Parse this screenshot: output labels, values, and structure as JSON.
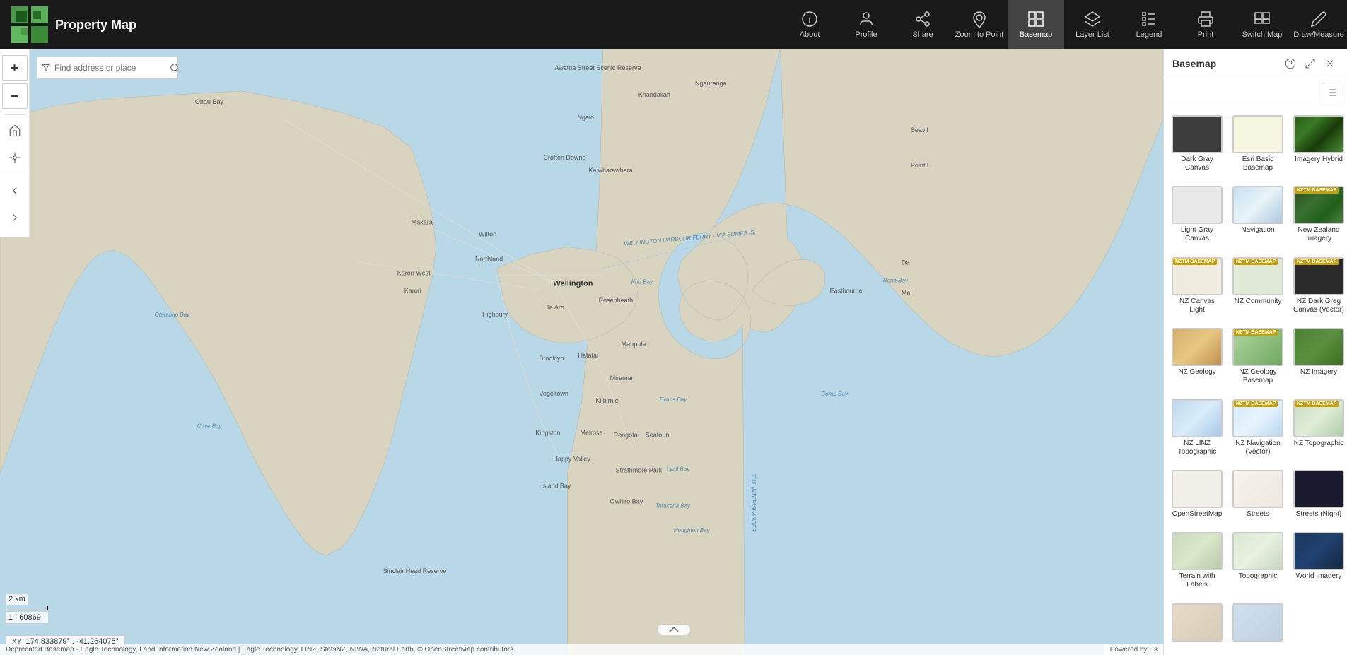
{
  "app": {
    "title": "Property Map"
  },
  "toolbar": {
    "buttons": [
      {
        "id": "about",
        "label": "About",
        "icon": "info"
      },
      {
        "id": "profile",
        "label": "Profile",
        "icon": "profile"
      },
      {
        "id": "share",
        "label": "Share",
        "icon": "share"
      },
      {
        "id": "zoom-to-point",
        "label": "Zoom to Point",
        "icon": "zoom-point"
      },
      {
        "id": "basemap",
        "label": "Basemap",
        "icon": "basemap",
        "active": true
      },
      {
        "id": "layer-list",
        "label": "Layer List",
        "icon": "layer-list"
      },
      {
        "id": "legend",
        "label": "Legend",
        "icon": "legend"
      },
      {
        "id": "print",
        "label": "Print",
        "icon": "print"
      },
      {
        "id": "switch-map",
        "label": "Switch Map",
        "icon": "switch-map"
      },
      {
        "id": "draw-measure",
        "label": "Draw/Measure",
        "icon": "draw"
      }
    ]
  },
  "sidebar": {
    "zoom_in": "+",
    "zoom_out": "−"
  },
  "search": {
    "placeholder": "Find address or place"
  },
  "basemap_panel": {
    "title": "Basemap",
    "items": [
      {
        "id": "dark-gray-canvas",
        "label": "Dark Gray Canvas",
        "thumb_class": "thumb-dark-gray"
      },
      {
        "id": "esri-basic",
        "label": "Esri Basic Basemap",
        "thumb_class": "thumb-esri-basic"
      },
      {
        "id": "imagery-hybrid",
        "label": "Imagery Hybrid",
        "thumb_class": "thumb-imagery-hybrid"
      },
      {
        "id": "light-gray-canvas",
        "label": "Light Gray Canvas",
        "thumb_class": "thumb-light-gray"
      },
      {
        "id": "navigation",
        "label": "Navigation",
        "thumb_class": "thumb-navigation"
      },
      {
        "id": "new-zealand-imagery",
        "label": "New Zealand Imagery",
        "thumb_class": "thumb-nz-imagery",
        "badge": "NZTM BASEMAP"
      },
      {
        "id": "nz-canvas-light",
        "label": "NZ Canvas Light",
        "thumb_class": "thumb-nz-canvas-light",
        "badge": "NZTM BASEMAP"
      },
      {
        "id": "nz-community",
        "label": "NZ Community",
        "thumb_class": "thumb-nz-community",
        "badge": "NZTM BASEMAP"
      },
      {
        "id": "nz-dark-greg",
        "label": "NZ Dark Greg Canvas (Vector)",
        "thumb_class": "thumb-nz-dark-gray",
        "badge": "NZTM BASEMAP"
      },
      {
        "id": "nz-geology",
        "label": "NZ Geology",
        "thumb_class": "thumb-nz-geology"
      },
      {
        "id": "nz-geology-basemap",
        "label": "NZ Geology Basemap",
        "thumb_class": "thumb-nz-geology-bm",
        "badge": "NZTM BASEMAP"
      },
      {
        "id": "nz-imagery",
        "label": "NZ Imagery",
        "thumb_class": "thumb-nz-imagery-bm"
      },
      {
        "id": "nz-linz-topographic",
        "label": "NZ LINZ Topographic",
        "thumb_class": "thumb-nz-linz-topo"
      },
      {
        "id": "nz-navigation-vector",
        "label": "NZ Navigation (Vector)",
        "thumb_class": "thumb-nz-nav-vector",
        "badge": "NZTM BASEMAP"
      },
      {
        "id": "nz-topographic",
        "label": "NZ Topographic",
        "thumb_class": "thumb-nz-topo",
        "badge": "NZTM BASEMAP"
      },
      {
        "id": "openstreetmap",
        "label": "OpenStreetMap",
        "thumb_class": "thumb-openstreetmap"
      },
      {
        "id": "streets",
        "label": "Streets",
        "thumb_class": "thumb-streets"
      },
      {
        "id": "streets-night",
        "label": "Streets (Night)",
        "thumb_class": "thumb-streets-night"
      },
      {
        "id": "terrain-labels",
        "label": "Terrain with Labels",
        "thumb_class": "thumb-terrain"
      },
      {
        "id": "topographic",
        "label": "Topographic",
        "thumb_class": "thumb-topographic"
      },
      {
        "id": "world-imagery",
        "label": "World Imagery",
        "thumb_class": "thumb-world-imagery"
      },
      {
        "id": "extra1",
        "label": "",
        "thumb_class": "thumb-extra1"
      },
      {
        "id": "extra2",
        "label": "",
        "thumb_class": "thumb-extra2"
      }
    ]
  },
  "scale": {
    "bar_label": "2 km",
    "ratio": "1 : 60869"
  },
  "coordinates": {
    "x": "174.833879°",
    "y": "-41.264075°"
  },
  "attribution": {
    "text": "Deprecated Basemap - Eagle Technology, Land Information New Zealand | Eagle Technology, LINZ, StatsNZ, NIWA, Natural Earth, © OpenStreetMap contributors.",
    "powered_by": "Powered by Es"
  }
}
